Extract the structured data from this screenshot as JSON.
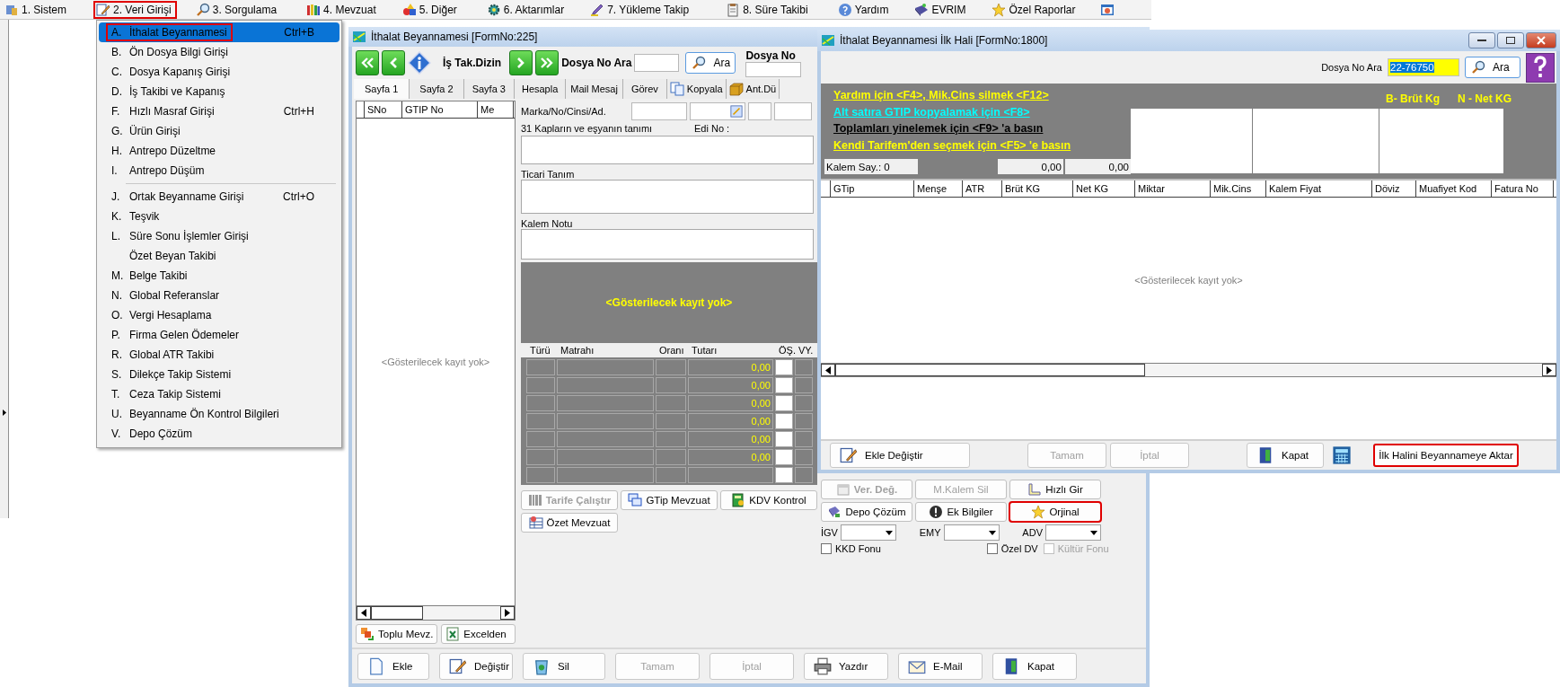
{
  "menu_bar": {
    "items": [
      {
        "label": "1. Sistem",
        "highlighted": false
      },
      {
        "label": "2. Veri Girişi",
        "highlighted": true
      },
      {
        "label": "3. Sorgulama",
        "highlighted": false
      },
      {
        "label": "4. Mevzuat",
        "highlighted": false
      },
      {
        "label": "5. Diğer",
        "highlighted": false
      },
      {
        "label": "6. Aktarımlar",
        "highlighted": false
      },
      {
        "label": "7. Yükleme Takip",
        "highlighted": false
      },
      {
        "label": "8. Süre Takibi",
        "highlighted": false
      },
      {
        "label": "Yardım",
        "highlighted": false
      },
      {
        "label": "EVRIM",
        "highlighted": false
      },
      {
        "label": "Özel Raporlar",
        "highlighted": false
      }
    ]
  },
  "dropdown": {
    "groups": [
      [
        {
          "key": "A.",
          "label": "İthalat Beyannamesi",
          "shortcut": "Ctrl+B",
          "selected": true,
          "highlighted": true
        },
        {
          "key": "B.",
          "label": "Ön Dosya Bilgi Girişi",
          "selected": false,
          "highlighted": false
        },
        {
          "key": "C.",
          "label": "Dosya Kapanış Girişi",
          "selected": false,
          "highlighted": false
        },
        {
          "key": "D.",
          "label": "İş Takibi ve Kapanış",
          "selected": false,
          "highlighted": false
        },
        {
          "key": "F.",
          "label": "Hızlı Masraf Girişi",
          "shortcut": "Ctrl+H",
          "selected": false,
          "highlighted": false
        },
        {
          "key": "G.",
          "label": "Ürün Girişi",
          "selected": false,
          "highlighted": false
        },
        {
          "key": "H.",
          "label": "Antrepo Düzeltme",
          "selected": false,
          "highlighted": false
        },
        {
          "key": "I.",
          "label": "Antrepo Düşüm",
          "selected": false,
          "highlighted": false
        }
      ],
      [
        {
          "key": "J.",
          "label": "Ortak Beyanname Girişi",
          "shortcut": "Ctrl+O",
          "selected": false,
          "highlighted": false
        },
        {
          "key": "K.",
          "label": "Teşvik",
          "selected": false,
          "highlighted": false
        },
        {
          "key": "L.",
          "label": "Süre Sonu İşlemler Girişi",
          "selected": false,
          "highlighted": false
        },
        {
          "label": "Özet Beyan Takibi",
          "selected": false,
          "highlighted": false
        },
        {
          "key": "M.",
          "label": "Belge Takibi",
          "selected": false,
          "highlighted": false
        },
        {
          "key": "N.",
          "label": "Global Referanslar",
          "selected": false,
          "highlighted": false
        },
        {
          "key": "O.",
          "label": "Vergi Hesaplama",
          "selected": false,
          "highlighted": false
        },
        {
          "key": "P.",
          "label": "Firma Gelen Ödemeler",
          "selected": false,
          "highlighted": false
        },
        {
          "key": "R.",
          "label": "Global ATR Takibi",
          "selected": false,
          "highlighted": false
        },
        {
          "key": "S.",
          "label": "Dilekçe Takip Sistemi",
          "selected": false,
          "highlighted": false
        },
        {
          "key": "T.",
          "label": "Ceza Takip Sistemi",
          "selected": false,
          "highlighted": false
        },
        {
          "key": "U.",
          "label": "Beyanname Ön Kontrol Bilgileri",
          "selected": false,
          "highlighted": false
        },
        {
          "key": "V.",
          "label": "Depo Çözüm",
          "selected": false,
          "highlighted": false
        }
      ]
    ]
  },
  "main_window": {
    "title": "İthalat Beyannamesi [FormNo:225]",
    "toolbar": {
      "dizin_label": "İş Tak.Dizin",
      "search_label": "Dosya No Ara",
      "search_button": "Ara",
      "dosya_no_label": "Dosya No"
    },
    "tabs": [
      {
        "label": "Sayfa 1",
        "selected": true
      },
      {
        "label": "Sayfa 2",
        "selected": false
      },
      {
        "label": "Sayfa 3",
        "selected": false
      },
      {
        "label": "Hesapla",
        "selected": false
      },
      {
        "label": "Mail Mesaj",
        "selected": false
      },
      {
        "label": "Görev",
        "selected": false
      },
      {
        "label": "Kopyala",
        "selected": false
      },
      {
        "label": "Ant.Dü",
        "selected": false
      }
    ],
    "list": {
      "columns": [
        "SNo",
        "GTIP No",
        "Me"
      ],
      "empty_text": "<Gösterilecek kayıt yok>"
    },
    "list_buttons": [
      "Toplu Mevz.",
      "Excelden"
    ],
    "form": {
      "marka_label": "Marka/No/Cinsi/Ad.",
      "description_label": "31 Kapların ve eşyanın tanımı",
      "edi_label": "Edi No :",
      "trade_label": "Ticari Tanım",
      "note_label": "Kalem Notu",
      "panel_text": "<Gösterilecek kayıt yok>"
    },
    "tax_table": {
      "columns": [
        "Türü",
        "Matrahı",
        "Oranı",
        "Tutarı",
        "ÖŞ.",
        "VY."
      ],
      "rows": [
        {
          "amount": "0,00"
        },
        {
          "amount": "0,00"
        },
        {
          "amount": "0,00"
        },
        {
          "amount": "0,00"
        },
        {
          "amount": "0,00"
        },
        {
          "amount": "0,00"
        },
        {}
      ]
    },
    "form_buttons": [
      {
        "label": "Tarife Çalıştır",
        "disabled": true
      },
      {
        "label": "GTip Mevzuat",
        "disabled": false
      },
      {
        "label": "KDV Kontrol",
        "disabled": false
      },
      {
        "label": "Özet Mevzuat",
        "disabled": false
      }
    ],
    "side_buttons": [
      {
        "label": "Ver. Değ.",
        "disabled": true,
        "highlighted": false
      },
      {
        "label": "M.Kalem Sil",
        "disabled": true,
        "highlighted": false
      },
      {
        "label": "Hızlı Gir",
        "disabled": false,
        "highlighted": false
      },
      {
        "label": "Depo Çözüm",
        "disabled": false,
        "highlighted": false
      },
      {
        "label": "Ek Bilgiler",
        "disabled": false,
        "highlighted": false
      },
      {
        "label": "Orjinal",
        "disabled": false,
        "highlighted": true
      }
    ],
    "selects": [
      {
        "label": "İGV"
      },
      {
        "label": "EMY"
      },
      {
        "label": "ADV"
      }
    ],
    "checkboxes": [
      {
        "label": "KKD Fonu",
        "checked": false,
        "disabled": false
      },
      {
        "label": "Özel DV",
        "checked": false,
        "disabled": false
      },
      {
        "label": "Kültür Fonu",
        "checked": false,
        "disabled": true
      }
    ],
    "bottom_buttons": [
      {
        "label": "Ekle",
        "disabled": false
      },
      {
        "label": "Değiştir",
        "disabled": false
      },
      {
        "label": "Sil",
        "disabled": false
      },
      {
        "label": "Tamam",
        "disabled": true
      },
      {
        "label": "İptal",
        "disabled": true
      },
      {
        "label": "Yazdır",
        "disabled": false
      },
      {
        "label": "E-Mail",
        "disabled": false
      },
      {
        "label": "Kapat",
        "disabled": false
      }
    ]
  },
  "second_window": {
    "title": "İthalat Beyannamesi İlk Hali [FormNo:1800]",
    "search_label": "Dosya No Ara",
    "search_value": "22-76750",
    "search_button": "Ara",
    "hints": [
      {
        "text": "Yardım için <F4>, Mik.Cins silmek <F12>",
        "color": "#ffff00"
      },
      {
        "text": "Alt satıra GTIP kopyalamak için <F8>",
        "color": "#00ffff"
      },
      {
        "text": "Toplamları yinelemek için <F9> 'a basın",
        "color": "#000000"
      },
      {
        "text": "Kendi Tarifem'den seçmek  için <F5> 'e basın",
        "color": "#ffff00"
      }
    ],
    "weight_labels": [
      "B- Brüt Kg",
      "N - Net KG"
    ],
    "item_count": "Kalem Say.: 0",
    "totals": [
      "0,00",
      "0,00"
    ],
    "grid": {
      "columns": [
        "GTip",
        "Menşe",
        "ATR",
        "Brüt KG",
        "Net KG",
        "Miktar",
        "Mik.Cins",
        "Kalem Fiyat",
        "Döviz",
        "Muafiyet Kod",
        "Fatura No"
      ],
      "empty_text": "<Gösterilecek kayıt yok>"
    },
    "buttons": [
      {
        "label": "Ekle Değiştir",
        "disabled": false,
        "highlighted": false
      },
      {
        "label": "Tamam",
        "disabled": true,
        "highlighted": false
      },
      {
        "label": "İptal",
        "disabled": true,
        "highlighted": false
      },
      {
        "label": "Kapat",
        "disabled": false,
        "highlighted": false
      },
      {
        "label": "İlk Halini Beyannameye Aktar",
        "disabled": false,
        "highlighted": true
      }
    ]
  }
}
